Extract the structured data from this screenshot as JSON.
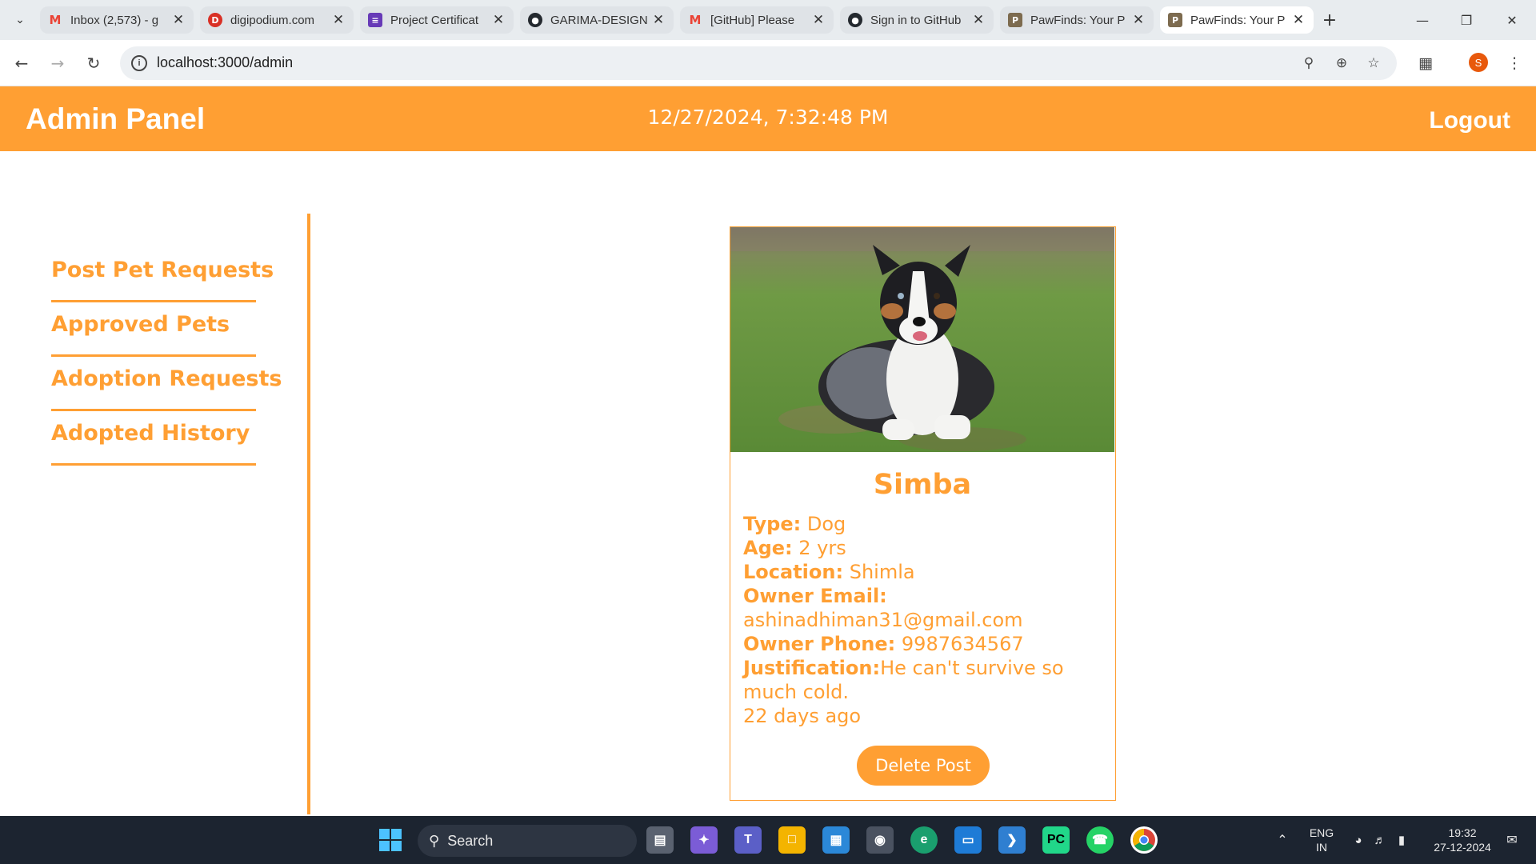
{
  "browser": {
    "tabs": [
      {
        "title": "Inbox (2,573) - g",
        "icon": "gmail-icon",
        "color": "#ea4335"
      },
      {
        "title": "digipodium.com",
        "icon": "digipodium-icon",
        "color": "#d93025"
      },
      {
        "title": "Project Certificat",
        "icon": "forms-icon",
        "color": "#673ab7"
      },
      {
        "title": "GARIMA-DESIGN",
        "icon": "github-icon",
        "color": "#24292f"
      },
      {
        "title": "[GitHub] Please",
        "icon": "gmail-icon",
        "color": "#ea4335"
      },
      {
        "title": "Sign in to GitHub",
        "icon": "github-icon",
        "color": "#24292f"
      },
      {
        "title": "PawFinds: Your P",
        "icon": "pawfinds-icon",
        "color": "#7d6b4f"
      },
      {
        "title": "PawFinds: Your P",
        "icon": "pawfinds-icon",
        "color": "#7d6b4f"
      }
    ],
    "url": "localhost:3000/admin",
    "profile_initial": "S"
  },
  "header": {
    "title": "Admin Panel",
    "datetime": "12/27/2024, 7:32:48 PM",
    "logout_label": "Logout"
  },
  "sidebar": {
    "items": [
      {
        "label": "Post Pet Requests"
      },
      {
        "label": "Approved Pets"
      },
      {
        "label": "Adoption Requests"
      },
      {
        "label": "Adopted History"
      }
    ]
  },
  "pet_card": {
    "name": "Simba",
    "photo": "dog-photo",
    "type_label": "Type:",
    "type_value": "Dog",
    "age_label": "Age:",
    "age_value": "2 yrs",
    "location_label": "Location:",
    "location_value": "Shimla",
    "owner_email_label": "Owner Email:",
    "owner_email_value": "ashinadhiman31@gmail.com",
    "owner_phone_label": "Owner Phone:",
    "owner_phone_value": "9987634567",
    "justification_label": "Justification:",
    "justification_value": "He can't survive so much cold.",
    "posted_ago": "22 days ago",
    "delete_label": "Delete Post"
  },
  "taskbar": {
    "search_label": "Search",
    "lang_line1": "ENG",
    "lang_line2": "IN",
    "time": "19:32",
    "date": "27-12-2024"
  },
  "colors": {
    "accent": "#ff9f33",
    "taskbar": "#1c2430"
  }
}
